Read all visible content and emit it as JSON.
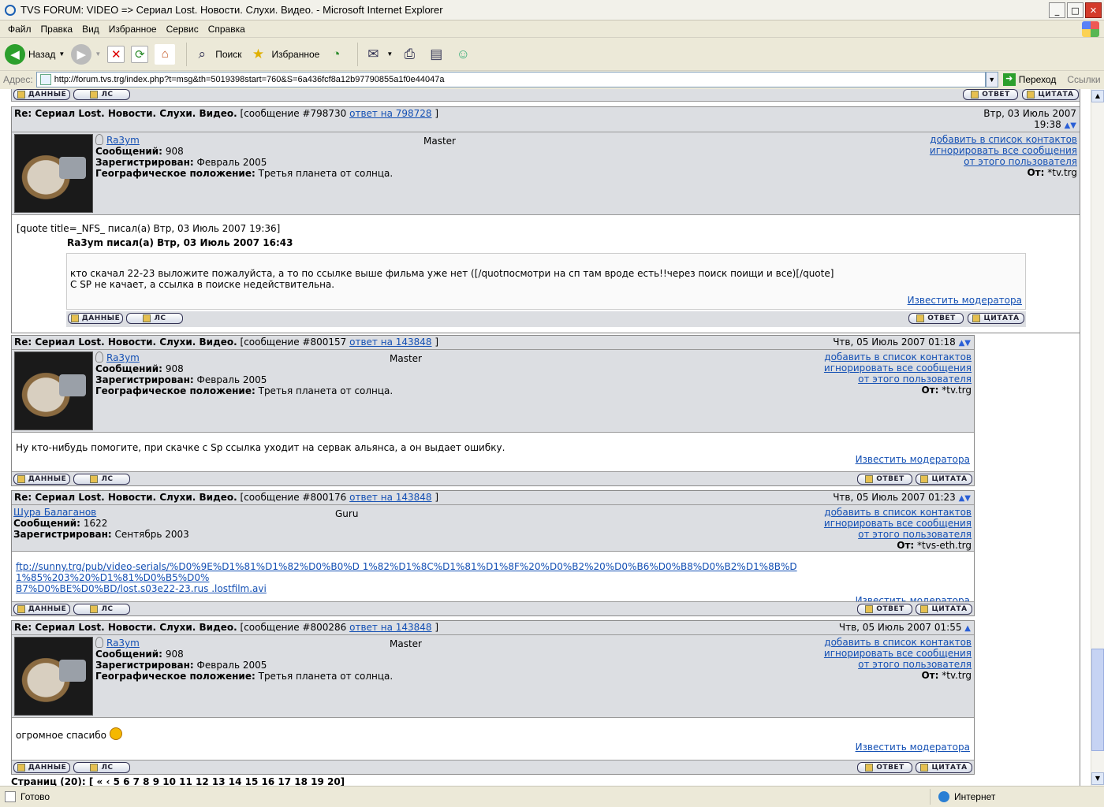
{
  "window": {
    "title": "TVS FORUM: VIDEO => Сериал Lost. Новости. Слухи. Видео. - Microsoft Internet Explorer"
  },
  "menu": [
    "Файл",
    "Правка",
    "Вид",
    "Избранное",
    "Сервис",
    "Справка"
  ],
  "toolbar": {
    "back": "Назад",
    "search": "Поиск",
    "favorites": "Избранное"
  },
  "address": {
    "label": "Адрес:",
    "url": "http://forum.tvs.trg/index.php?t=msg&th=5019398start=760&S=6a436fcf8a12b97790855a1f0e44047a",
    "go": "Переход",
    "links": "Ссылки"
  },
  "buttons": {
    "data": "ДАННЫЕ",
    "pm": "ЛС",
    "reply": "ОТВЕТ",
    "quote": "ЦИТАТА"
  },
  "common": {
    "thread": "Re: Сериал Lost. Новости. Слухи. Видео.",
    "add_contact": "добавить в список контактов",
    "ignore_all": "игнорировать все сообщения",
    "from_user": "от этого пользователя",
    "from_label": "От:",
    "posts_label": "Сообщений:",
    "registered_label": "Зарегистрирован:",
    "location_label": "Географическое положение:",
    "report": "Известить модератора"
  },
  "posts": [
    {
      "msg": "[сообщение #798730",
      "reply_to": "ответ на 798728",
      "date": "Втр, 03 Июль 2007",
      "time": "19:38",
      "user": "Ra3ym",
      "rank": "Master",
      "posts": "908",
      "registered": "Февраль 2005",
      "location": "Третья планета от солнца.",
      "from": "*tv.trg",
      "quote_open": "[quote title=_NFS_ писал(а) Втр, 03 Июль 2007 19:36]",
      "quote_author": "Ra3ym писал(а) Втр, 03 Июль 2007 16:43",
      "quote_line1": "кто скачал 22-23 выложите пожалуйста, а то по ссылке выше фильма уже нет ([/quotпосмотри на сп там вроде есть!!через поиск поищи и все)[/quote]",
      "quote_line2": "С SP не качает, а ссылка в поиске недействительна."
    },
    {
      "msg": "[сообщение #800157",
      "reply_to": "ответ на 143848",
      "date": "Чтв, 05 Июль 2007 01:18",
      "user": "Ra3ym",
      "rank": "Master",
      "posts": "908",
      "registered": "Февраль 2005",
      "location": "Третья планета от солнца.",
      "from": "*tv.trg",
      "body": "Ну кто-нибудь помогите, при скачке с Sp ссылка уходит на сервак альянса, а он выдает ошибку."
    },
    {
      "msg": "[сообщение #800176",
      "reply_to": "ответ на 143848",
      "date": "Чтв, 05 Июль 2007 01:23",
      "user": "Шура Балаганов",
      "rank": "Guru",
      "posts": "1622",
      "registered": "Сентябрь 2003",
      "from": "*tvs-eth.trg",
      "link1": "ftp://sunny.trg/pub/video-serials/%D0%9E%D1%81%D1%82%D0%B0%D 1%82%D1%8C%D1%81%D1%8F%20%D0%B2%20%D0%B6%D0%B8%D0%B2%D1%8B%D 1%85%203%20%D1%81%D0%B5%D0%",
      "link2": "B7%D0%BE%D0%BD/lost.s03e22-23.rus .lostfilm.avi"
    },
    {
      "msg": "[сообщение #800286",
      "reply_to": "ответ на 143848",
      "date": "Чтв, 05 Июль 2007 01:55",
      "user": "Ra3ym",
      "rank": "Master",
      "posts": "908",
      "registered": "Февраль 2005",
      "location": "Третья планета от солнца.",
      "from": "*tv.trg",
      "body": "огромное спасибо"
    }
  ],
  "pager": "Страниц (20): [ « ‹ 5 6 7 8 9 10 11 12 13 14 15 16 17 18 19 20]",
  "status": {
    "ready": "Готово",
    "zone": "Интернет"
  }
}
